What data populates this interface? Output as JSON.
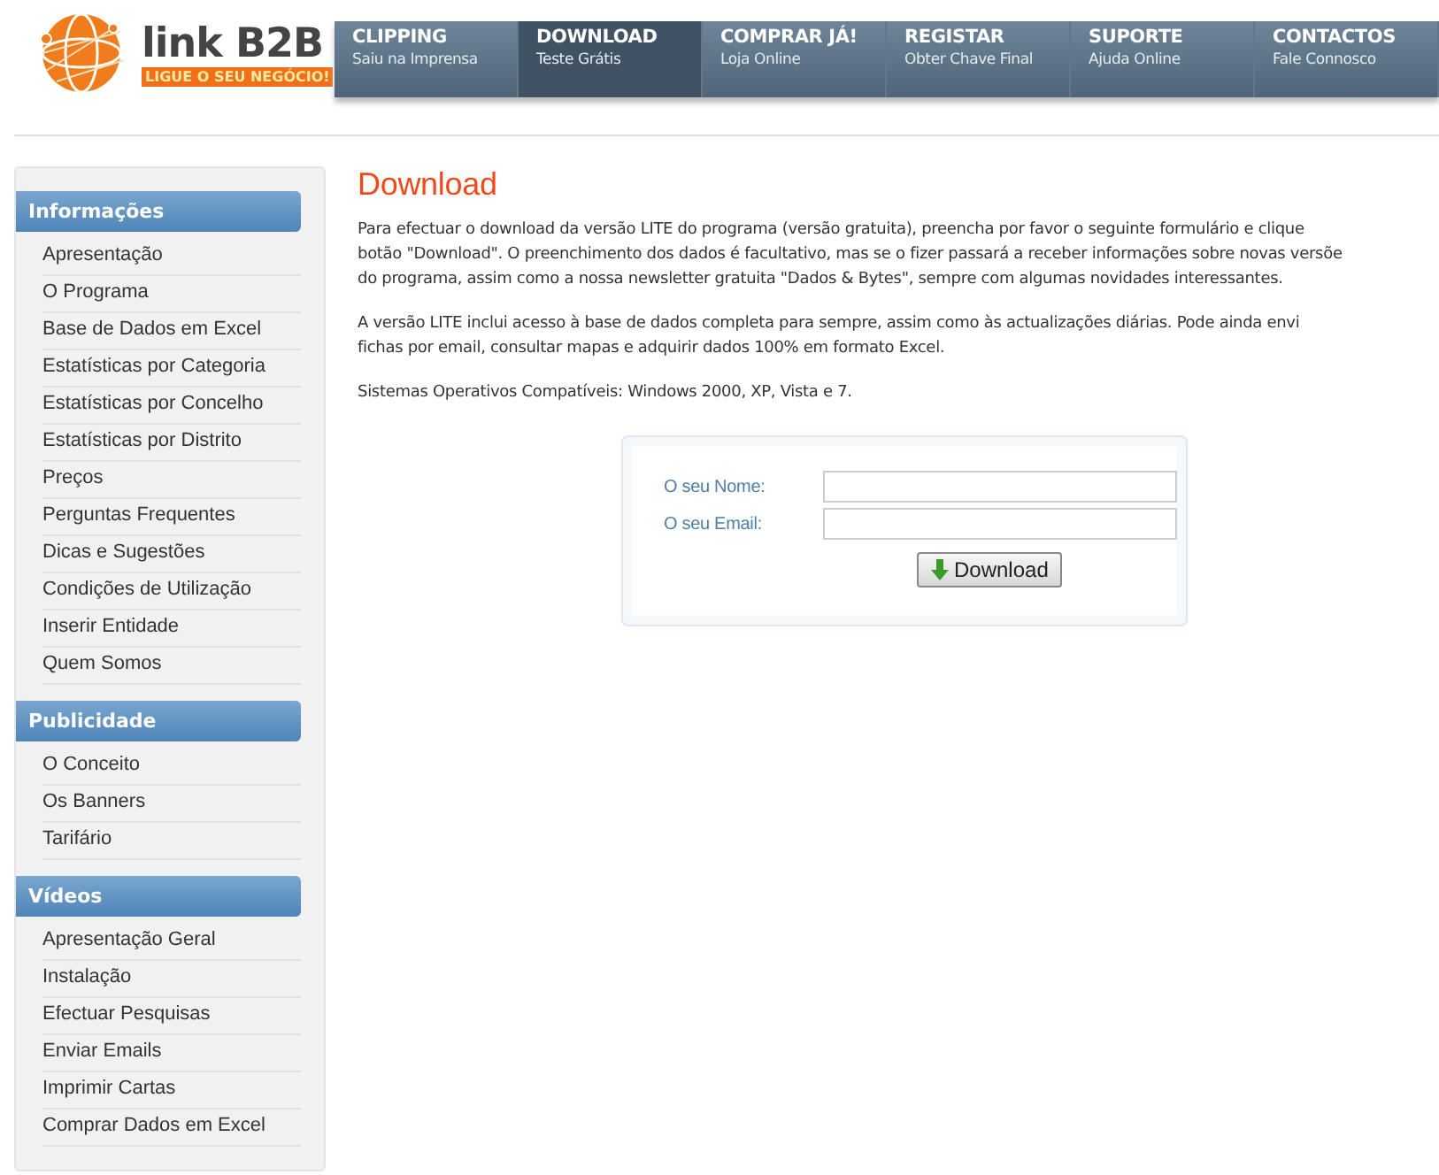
{
  "logo": {
    "name": "link B2B",
    "tagline": "LIGUE O SEU NEGÓCIO!"
  },
  "nav": [
    {
      "title": "CLIPPING",
      "subtitle": "Saiu na Imprensa",
      "selected": false
    },
    {
      "title": "DOWNLOAD",
      "subtitle": "Teste Grátis",
      "selected": true
    },
    {
      "title": "COMPRAR JÁ!",
      "subtitle": "Loja Online",
      "selected": false
    },
    {
      "title": "REGISTAR",
      "subtitle": "Obter Chave Final",
      "selected": false
    },
    {
      "title": "SUPORTE",
      "subtitle": "Ajuda Online",
      "selected": false
    },
    {
      "title": "CONTACTOS",
      "subtitle": "Fale Connosco",
      "selected": false
    }
  ],
  "sidebar": [
    {
      "heading": "Informações",
      "items": [
        "Apresentação",
        "O Programa",
        "Base de Dados em Excel",
        "Estatísticas por Categoria",
        "Estatísticas por Concelho",
        "Estatísticas por Distrito",
        "Preços",
        "Perguntas Frequentes",
        "Dicas e Sugestões",
        "Condições de Utilização",
        "Inserir Entidade",
        "Quem Somos"
      ]
    },
    {
      "heading": "Publicidade",
      "items": [
        "O Conceito",
        "Os Banners",
        "Tarifário"
      ]
    },
    {
      "heading": "Vídeos",
      "items": [
        "Apresentação Geral",
        "Instalação",
        "Efectuar Pesquisas",
        "Enviar Emails",
        "Imprimir Cartas",
        "Comprar Dados em Excel"
      ]
    }
  ],
  "content": {
    "title": "Download",
    "paragraphs": [
      [
        "Para efectuar o download da versão LITE do programa (versão gratuita), preencha por favor o seguinte formulário e clique",
        "botão \"Download\". O preenchimento dos dados é facultativo, mas se o fizer passará a receber informações sobre novas versõe",
        "do programa, assim como a nossa newsletter gratuita \"Dados & Bytes\", sempre com algumas novidades interessantes."
      ],
      [
        "A versão LITE inclui acesso à base de dados completa para sempre, assim como às actualizações diárias. Pode ainda envi",
        "fichas por email, consultar mapas e adquirir dados 100% em formato Excel."
      ],
      [
        "Sistemas Operativos Compatíveis: Windows 2000, XP, Vista e 7."
      ]
    ],
    "form": {
      "fields": [
        {
          "label": "O seu Nome:"
        },
        {
          "label": "O seu Email:"
        }
      ],
      "button": "Download"
    }
  }
}
